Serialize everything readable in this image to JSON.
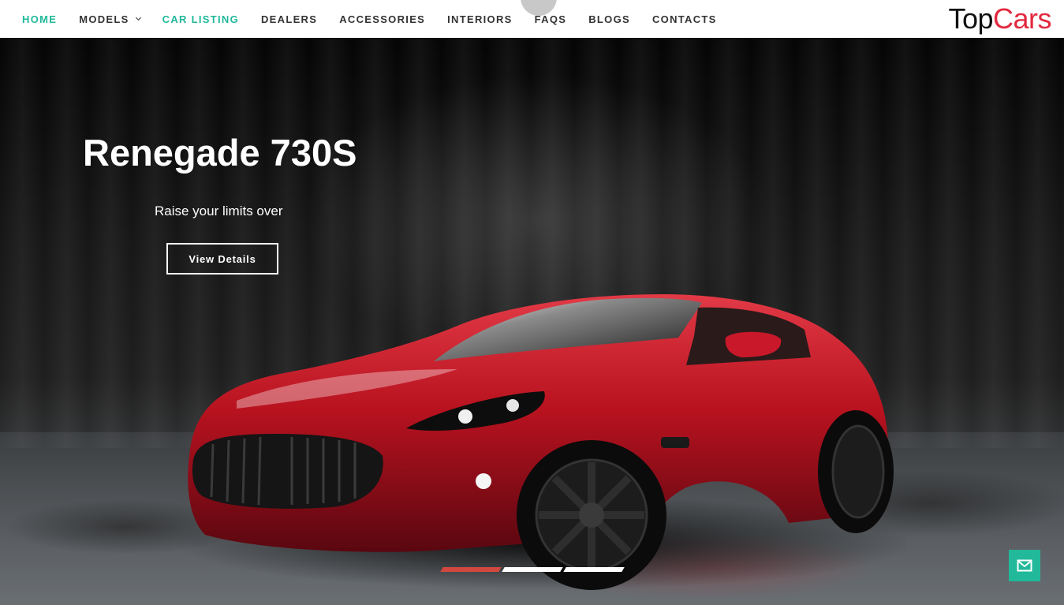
{
  "nav": {
    "items": [
      {
        "label": "HOME",
        "active": true
      },
      {
        "label": "MODELS",
        "has_dropdown": true
      },
      {
        "label": "CAR LISTING",
        "active": true
      },
      {
        "label": "DEALERS"
      },
      {
        "label": "ACCESSORIES"
      },
      {
        "label": "INTERIORS"
      },
      {
        "label": "FAQS"
      },
      {
        "label": "BLOGS"
      },
      {
        "label": "CONTACTS"
      }
    ]
  },
  "logo": {
    "part1": "Top",
    "part2": "Cars"
  },
  "hero": {
    "title": "Renegade 730S",
    "subtitle": "Raise your limits over",
    "button_label": "View Details"
  },
  "slider": {
    "slide_count": 3,
    "active_index": 0
  },
  "icons": {
    "dropdown": "chevron-down-icon",
    "mail": "mail-icon"
  },
  "colors": {
    "accent": "#20b99a",
    "brand_red": "#e2293f",
    "active_dot": "#d2483f",
    "mail_button": "#21b99a"
  }
}
